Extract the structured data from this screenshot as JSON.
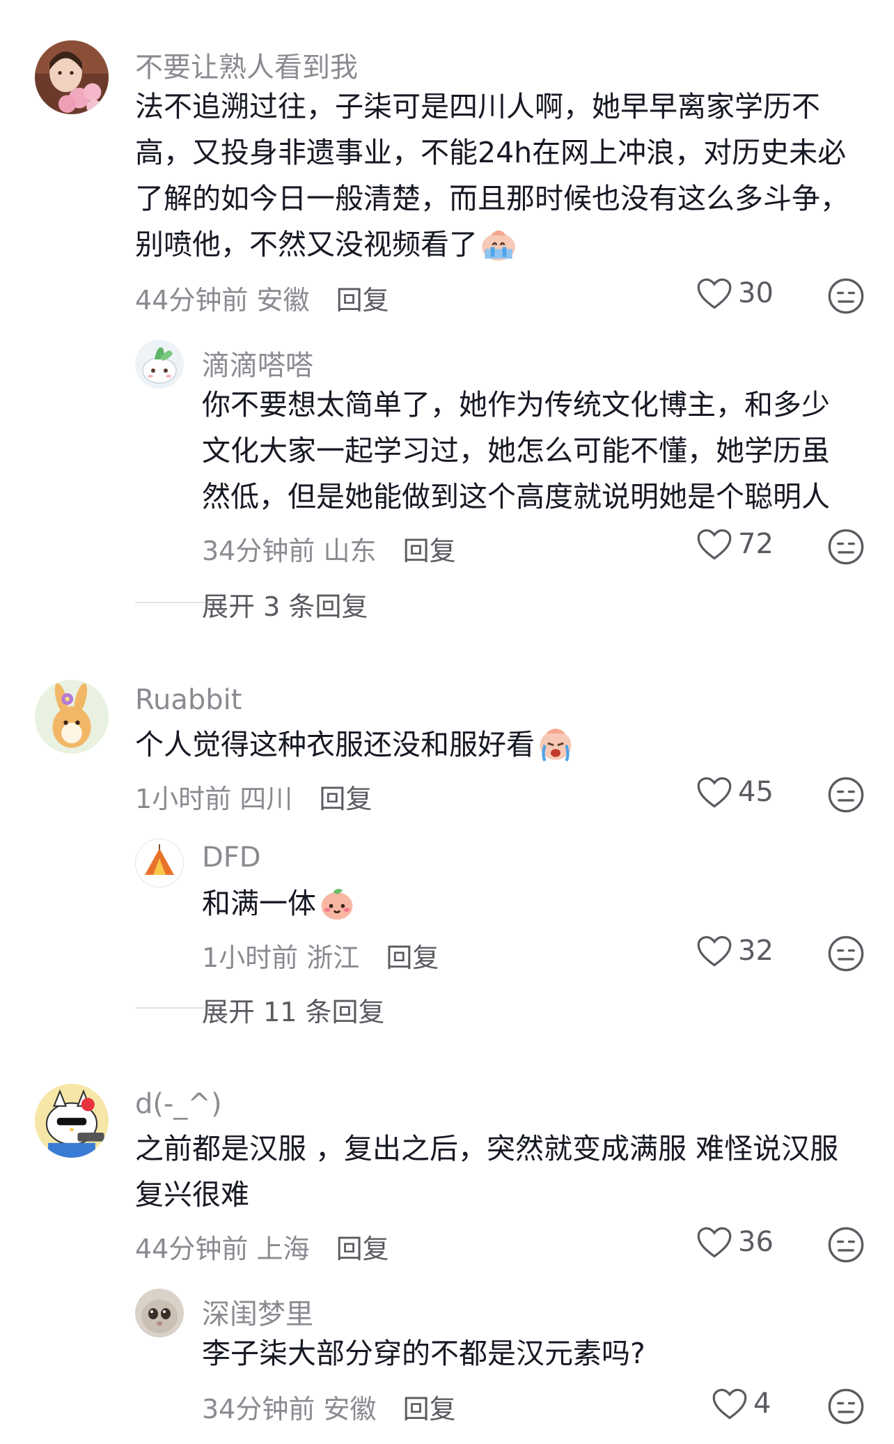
{
  "comments": [
    {
      "username": "不要让熟人看到我",
      "text": "法不追溯过往，子柒可是四川人啊，她早早离家学历不高，又投身非遗事业，不能24h在网上冲浪，对历史未必了解的如今日一般清楚，而且那时候也没有这么多斗争，别喷他，不然又没视频看了",
      "emoji": "crying-emoji",
      "time": "44分钟前",
      "location": "安徽",
      "reply_label": "回复",
      "likes": "30",
      "replies": [
        {
          "username": "滴滴嗒嗒",
          "text": "你不要想太简单了，她作为传统文化博主，和多少文化大家一起学习过，她怎么可能不懂，她学历虽然低，但是她能做到这个高度就说明她是个聪明人",
          "time": "34分钟前",
          "location": "山东",
          "reply_label": "回复",
          "likes": "72"
        }
      ],
      "expand_label": "展开 3 条回复"
    },
    {
      "username": "Ruabbit",
      "text": "个人觉得这种衣服还没和服好看",
      "emoji": "sobbing-emoji",
      "time": "1小时前",
      "location": "四川",
      "reply_label": "回复",
      "likes": "45",
      "replies": [
        {
          "username": "DFD",
          "text": "和满一体",
          "emoji": "peach-face-emoji",
          "time": "1小时前",
          "location": "浙江",
          "reply_label": "回复",
          "likes": "32"
        }
      ],
      "expand_label": "展开 11 条回复"
    },
    {
      "username": "d(-_^)",
      "text": "之前都是汉服 ，复出之后，突然就变成满服 难怪说汉服复兴很难",
      "time": "44分钟前",
      "location": "上海",
      "reply_label": "回复",
      "likes": "36",
      "replies": [
        {
          "username": "深闺梦里",
          "text": "李子柒大部分穿的不都是汉元素吗?",
          "time": "34分钟前",
          "location": "安徽",
          "reply_label": "回复",
          "likes": "4"
        }
      ]
    }
  ],
  "icons": {
    "like": "heart-outline-icon",
    "dislike": "meh-face-icon"
  },
  "colors": {
    "text": "#161823",
    "secondary": "#8a8b91",
    "reply": "#5a5b61"
  }
}
